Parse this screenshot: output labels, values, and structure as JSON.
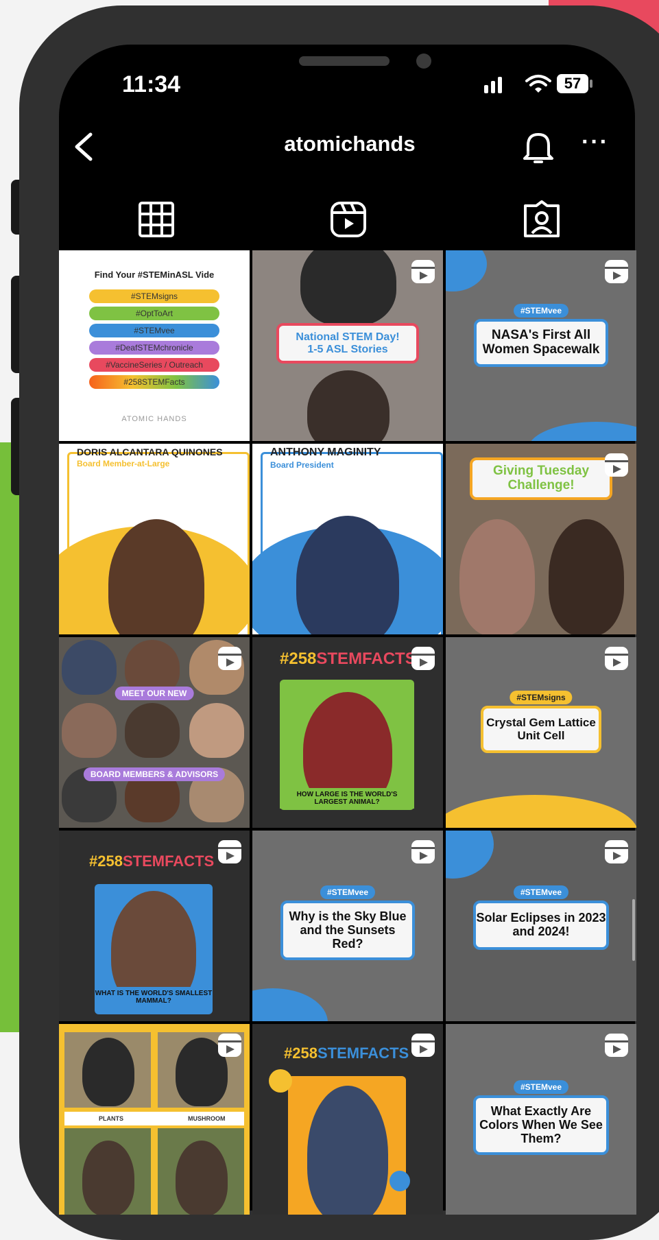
{
  "status_bar": {
    "time": "11:34",
    "battery": "57"
  },
  "header": {
    "username": "atomichands",
    "more_label": "···"
  },
  "grid": {
    "cell1": {
      "title": "Find Your #STEMinASL Vide",
      "pills": [
        "#STEMsigns",
        "#OptToArt",
        "#STEMvee",
        "#DeafSTEMchronicle",
        "#VaccineSeries / Outreach",
        "#258STEMFacts"
      ],
      "logo": "ATOMIC HANDS"
    },
    "cell2": {
      "line1": "National STEM Day!",
      "line2": "1-5 ASL Stories"
    },
    "cell3": {
      "tag": "#STEMvee",
      "title": "NASA's First All Women Spacewalk"
    },
    "cell4": {
      "name": "DORIS ALCANTARA QUINONES",
      "role": "Board Member-at-Large"
    },
    "cell5": {
      "name": "ANTHONY MAGINITY",
      "role": "Board President"
    },
    "cell6": {
      "title": "Giving Tuesday Challenge!"
    },
    "cell7": {
      "top": "MEET OUR NEW",
      "bottom": "BOARD MEMBERS & ADVISORS"
    },
    "cell8": {
      "num": "#258",
      "word": "STEMFACTS",
      "caption": "HOW LARGE IS THE WORLD'S LARGEST ANIMAL?"
    },
    "cell9": {
      "tag": "#STEMsigns",
      "title": "Crystal Gem Lattice Unit Cell"
    },
    "cell10": {
      "num": "#258",
      "word": "STEMFACTS",
      "caption": "WHAT IS THE WORLD'S SMALLEST MAMMAL?"
    },
    "cell11": {
      "tag": "#STEMvee",
      "title": "Why is the Sky Blue and the Sunsets Red?"
    },
    "cell12": {
      "tag": "#STEMvee",
      "title": "Solar Eclipses in 2023 and 2024!"
    },
    "cell13": {
      "label_left": "PLANTS",
      "label_right": "MUSHROOM"
    },
    "cell14": {
      "num": "#258",
      "word": "STEMFACTS"
    },
    "cell15": {
      "tag": "#STEMvee",
      "title": "What Exactly Are Colors When We See Them?"
    }
  },
  "colors": {
    "accent_blue": "#3b8fd9",
    "accent_yellow": "#f5c030",
    "pink": "#e8495e",
    "green": "#76bf3a",
    "dark_cell": "#2e2e2e"
  }
}
